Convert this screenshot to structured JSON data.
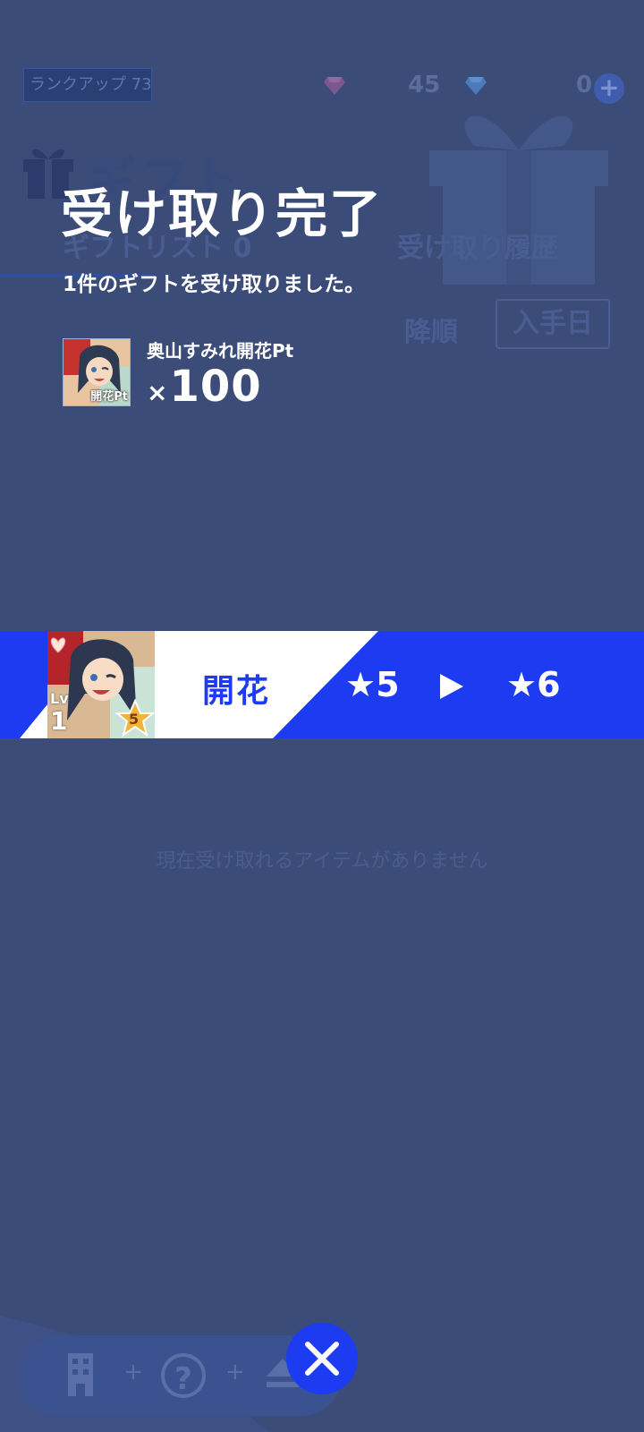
{
  "header": {
    "rank_label": "ランクアップ",
    "rank_value": "73",
    "gem_paid_count": "45",
    "gem_free_count": "0",
    "plus_label": "+"
  },
  "gift_screen": {
    "title": "ギフト",
    "tab_list": "ギフトリスト 0",
    "tab_history": "受け取り履歴",
    "sort_order": "降順",
    "sort_key": "入手日",
    "empty_message": "現在受け取れるアイテムがありません"
  },
  "result": {
    "title": "受け取り完了",
    "subtitle": "1件のギフトを受け取りました。",
    "item": {
      "name": "奥山すみれ開花Pt",
      "thumb_label": "開花Pt",
      "quantity_prefix": "×",
      "quantity": "100"
    }
  },
  "bloom_banner": {
    "label": "開花",
    "from": "★5",
    "to": "★6",
    "card_level_label": "Lv",
    "card_level": "1",
    "card_rarity": "5"
  },
  "bottom_nav": {
    "help_label": "?",
    "plus_label": "+"
  },
  "colors": {
    "overlay_bg": "#3b4c78",
    "accent_blue": "#1d3cf2",
    "text_white": "#ffffff"
  }
}
